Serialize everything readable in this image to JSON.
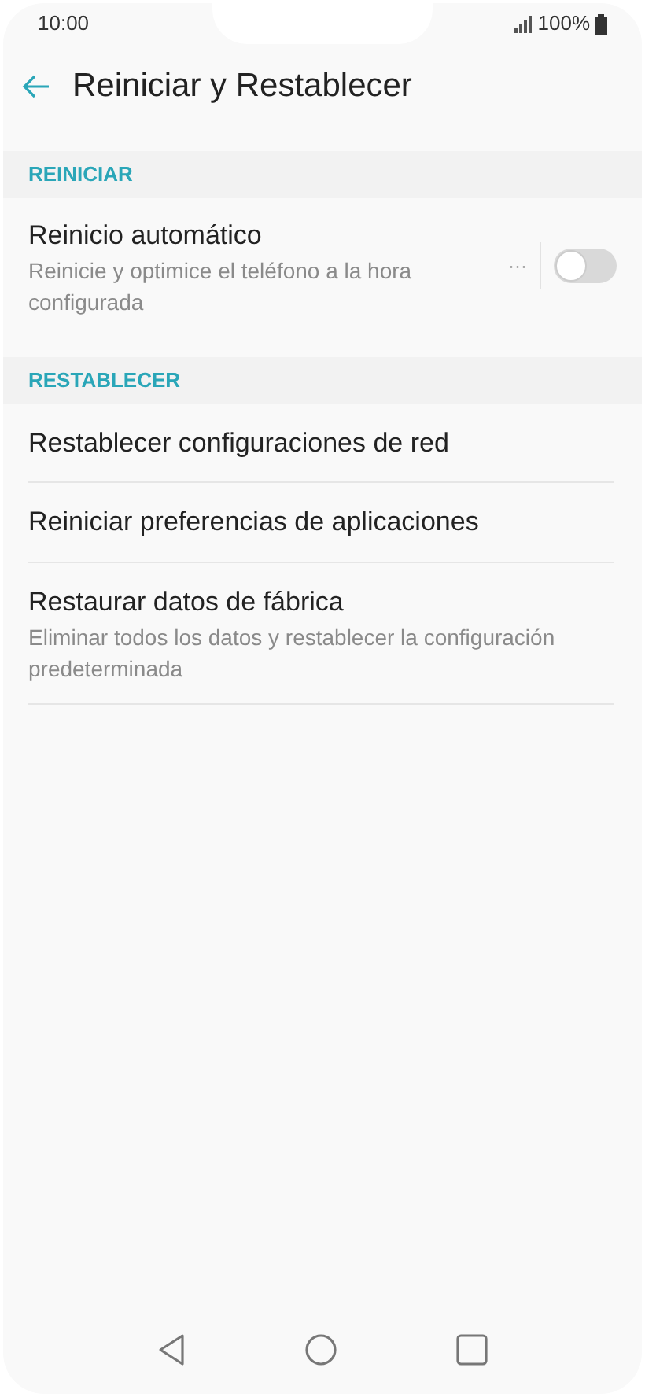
{
  "status_bar": {
    "time": "10:00",
    "battery": "100%"
  },
  "header": {
    "title": "Reiniciar y Restablecer"
  },
  "sections": [
    {
      "title": "REINICIAR",
      "items": [
        {
          "kind": "toggle",
          "title": "Reinicio automático",
          "subtitle": "Reinicie y optimice el teléfono a la hora configurada",
          "more": "···",
          "on": false
        }
      ]
    },
    {
      "title": "RESTABLECER",
      "items": [
        {
          "kind": "plain",
          "title": "Restablecer configuraciones de red"
        },
        {
          "kind": "plain",
          "title": "Reiniciar preferencias de aplicaciones"
        },
        {
          "kind": "plain",
          "title": "Restaurar datos de fábrica",
          "subtitle": "Eliminar todos los datos y restablecer la configuración predeterminada"
        }
      ]
    }
  ]
}
